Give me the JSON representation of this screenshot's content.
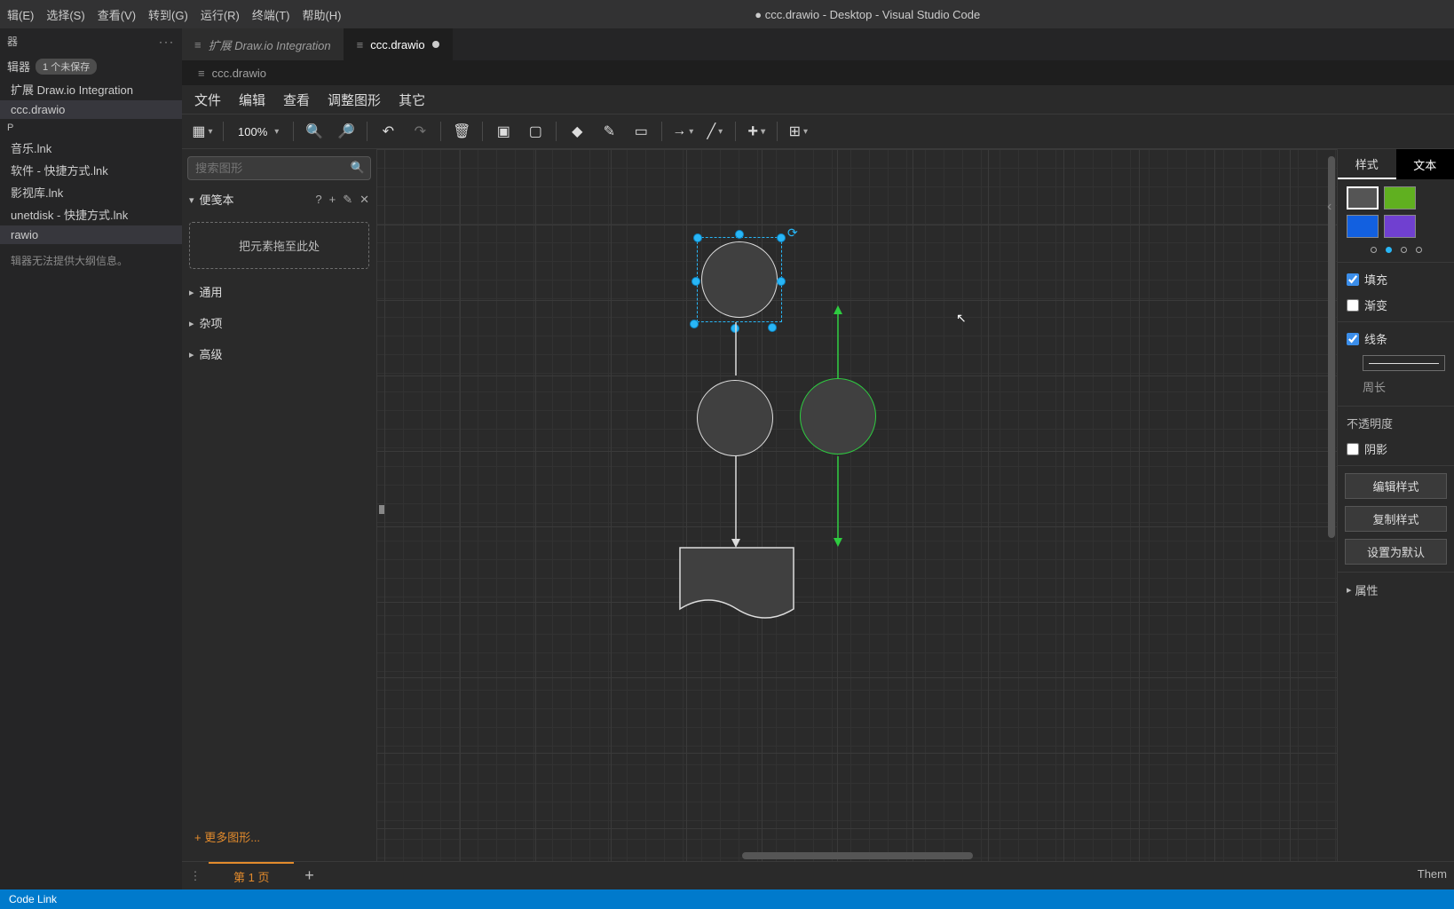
{
  "menubar": {
    "items": [
      "辑(E)",
      "选择(S)",
      "查看(V)",
      "转到(G)",
      "运行(R)",
      "终端(T)",
      "帮助(H)"
    ],
    "title": "● ccc.drawio - Desktop - Visual Studio Code"
  },
  "explorer": {
    "header": "器",
    "unsaved_row": {
      "label": "辑器",
      "badge": "1 个未保存"
    },
    "open_files": [
      "扩展 Draw.io Integration",
      "ccc.drawio"
    ],
    "section": "P",
    "files": [
      "音乐.lnk",
      "软件 - 快捷方式.lnk",
      "影视库.lnk",
      "unetdisk - 快捷方式.lnk",
      "rawio"
    ],
    "outline_hint": "辑器无法提供大纲信息。"
  },
  "tabs": [
    {
      "label": "扩展 Draw.io Integration",
      "active": false
    },
    {
      "label": "ccc.drawio",
      "active": true,
      "dirty": true
    }
  ],
  "breadcrumb": "ccc.drawio",
  "drawio_menu": [
    "文件",
    "编辑",
    "查看",
    "调整图形",
    "其它"
  ],
  "zoom": "100%",
  "shapes_panel": {
    "search_placeholder": "搜索图形",
    "scratch_label": "便笺本",
    "dropzone": "把元素拖至此处",
    "sections": [
      "通用",
      "杂项",
      "高级"
    ],
    "more": "+ 更多图形..."
  },
  "format_panel": {
    "tab_style": "样式",
    "tab_text": "文本",
    "swatches": [
      "#555555",
      "#60b020",
      "#1260e0",
      "#7040d0"
    ],
    "fill": "填充",
    "gradient": "渐变",
    "line": "线条",
    "perimeter": "周长",
    "opacity": "不透明度",
    "shadow": "阴影",
    "edit_style": "编辑样式",
    "copy_style": "复制样式",
    "set_default": "设置为默认",
    "attributes": "属性",
    "theme": "Them"
  },
  "page_tab": "第 1 页",
  "status": {
    "codelink": "Code Link"
  }
}
